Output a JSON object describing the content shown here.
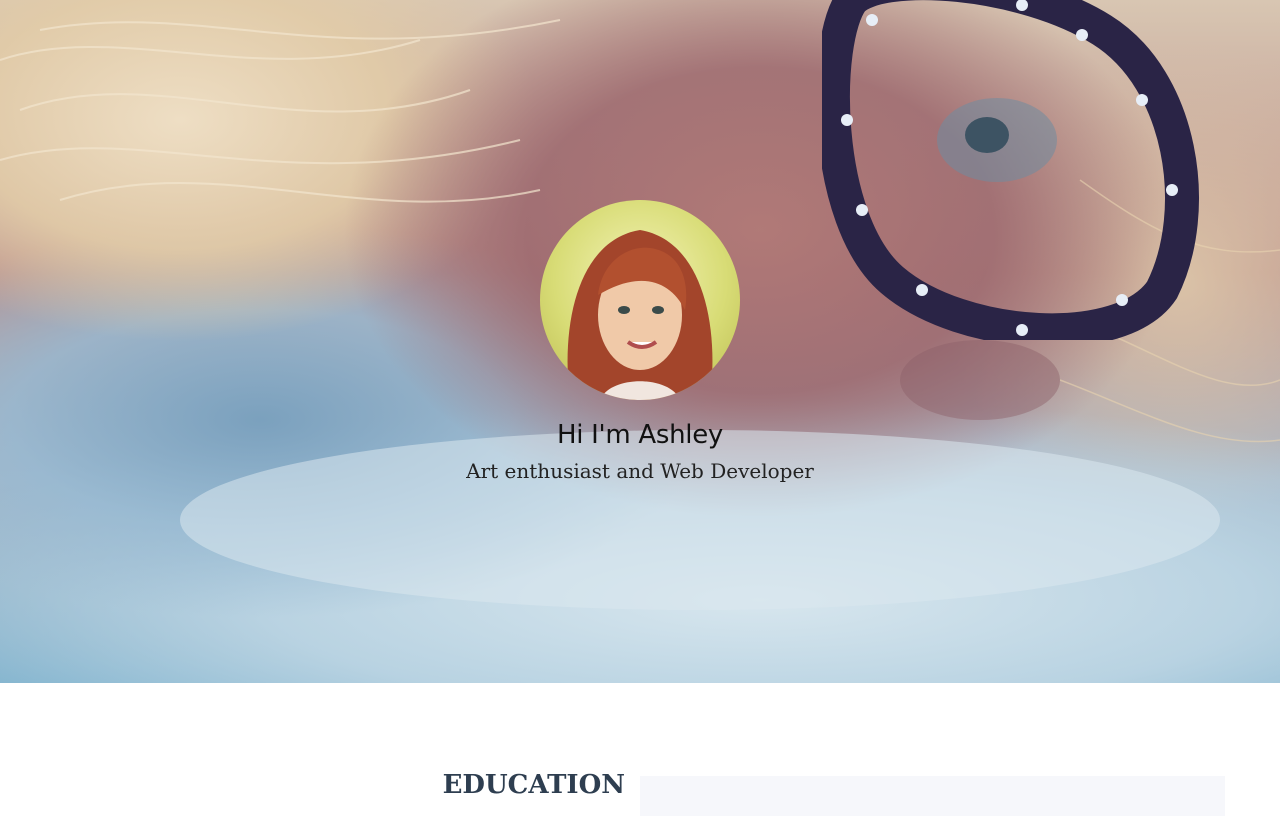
{
  "hero": {
    "title": "Hi I'm Ashley",
    "subtitle": "Art enthusiast and Web Developer",
    "background_image": "woman-with-glasses-photo",
    "avatar_image": "profile-photo"
  },
  "education": {
    "heading": "EDUCATION"
  },
  "colors": {
    "heading_color": "#2e3e50",
    "panel_background": "#f6f7fb"
  }
}
